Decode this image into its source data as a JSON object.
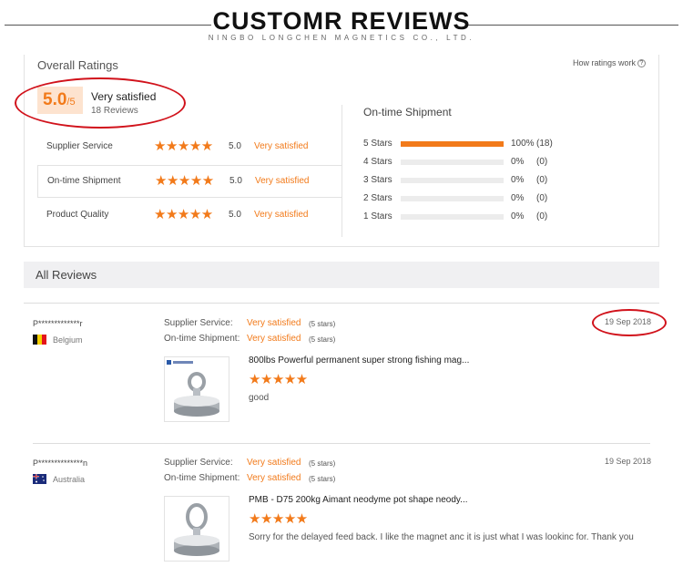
{
  "header": {
    "title": "CUSTOMR REVIEWS",
    "subtitle": "NINGBO LONGCHEN MAGNETICS CO., LTD."
  },
  "overall": {
    "title": "Overall Ratings",
    "how_link": "How ratings work",
    "score": "5.0",
    "score_suffix": "/5",
    "verdict": "Very satisfied",
    "review_count": "18 Reviews",
    "categories": [
      {
        "label": "Supplier Service",
        "score": "5.0",
        "verdict": "Very satisfied",
        "stars": 5
      },
      {
        "label": "On-time Shipment",
        "score": "5.0",
        "verdict": "Very satisfied",
        "stars": 5
      },
      {
        "label": "Product Quality",
        "score": "5.0",
        "verdict": "Very satisfied",
        "stars": 5
      }
    ],
    "shipment": {
      "title": "On-time Shipment",
      "rows": [
        {
          "label": "5  Stars",
          "fraction": 1.0,
          "pct": "100%",
          "count": "(18)"
        },
        {
          "label": "4  Stars",
          "fraction": 0,
          "pct": "0%",
          "count": "(0)"
        },
        {
          "label": "3  Stars",
          "fraction": 0,
          "pct": "0%",
          "count": "(0)"
        },
        {
          "label": "2  Stars",
          "fraction": 0,
          "pct": "0%",
          "count": "(0)"
        },
        {
          "label": "1  Stars",
          "fraction": 0,
          "pct": "0%",
          "count": "(0)"
        }
      ]
    }
  },
  "all_reviews": {
    "title": "All Reviews",
    "items": [
      {
        "name": "P*************r",
        "country": "Belgium",
        "supplier_label": "Supplier Service:",
        "supplier_val": "Very satisfied",
        "supplier_cnt": "(5 stars)",
        "ship_label": "On-time Shipment:",
        "ship_val": "Very satisfied",
        "ship_cnt": "(5 stars)",
        "date": "19 Sep 2018",
        "product": "800lbs Powerful permanent super strong fishing mag...",
        "stars": 5,
        "text": "good"
      },
      {
        "name": "P**************n",
        "country": "Australia",
        "supplier_label": "Supplier Service:",
        "supplier_val": "Very satisfied",
        "supplier_cnt": "(5 stars)",
        "ship_label": "On-time Shipment:",
        "ship_val": "Very satisfied",
        "ship_cnt": "(5 stars)",
        "date": "19 Sep 2018",
        "product": "PMB - D75 200kg Aimant neodyme pot shape neody...",
        "stars": 5,
        "text": "Sorry for the delayed feed back. I like the magnet anc it is just what I was lookinc for. Thank you"
      }
    ]
  },
  "stars_text": "★★★★★",
  "colors": {
    "accent": "#f27a1a",
    "annotation": "#d1121b"
  }
}
